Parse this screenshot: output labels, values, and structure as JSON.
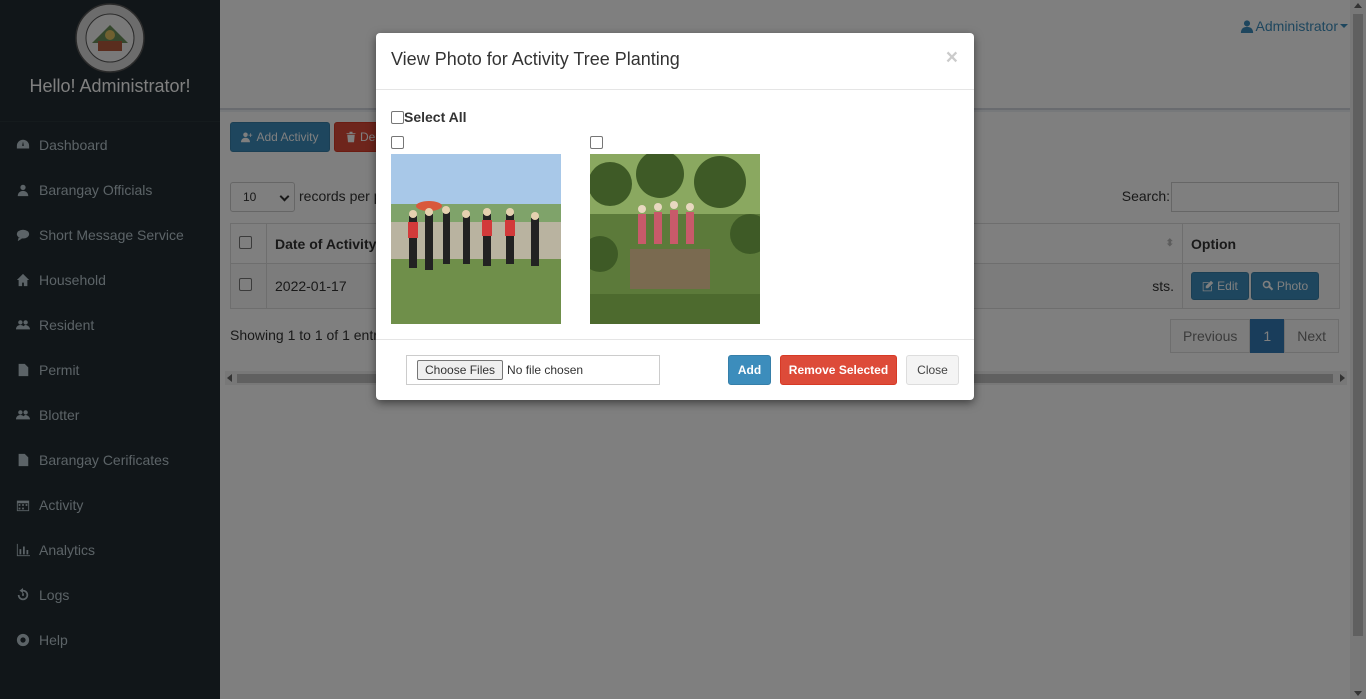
{
  "sidebar": {
    "greeting": "Hello! Administrator!",
    "items": [
      {
        "label": "Dashboard",
        "icon": "dashboard-icon"
      },
      {
        "label": "Barangay Officials",
        "icon": "user-icon"
      },
      {
        "label": "Short Message Service",
        "icon": "comment-icon"
      },
      {
        "label": "Household",
        "icon": "home-icon"
      },
      {
        "label": "Resident",
        "icon": "users-icon"
      },
      {
        "label": "Permit",
        "icon": "file-icon"
      },
      {
        "label": "Blotter",
        "icon": "users-icon"
      },
      {
        "label": "Barangay Cerificates",
        "icon": "file-icon"
      },
      {
        "label": "Activity",
        "icon": "calendar-icon"
      },
      {
        "label": "Analytics",
        "icon": "bar-chart-icon"
      },
      {
        "label": "Logs",
        "icon": "history-icon"
      },
      {
        "label": "Help",
        "icon": "life-ring-icon"
      }
    ]
  },
  "header": {
    "user": "Administrator"
  },
  "toolbar": {
    "add_label": "Add Activity",
    "delete_label": "Del"
  },
  "table": {
    "length_value": "10",
    "length_suffix": "records per p",
    "search_label": "Search:",
    "headers": {
      "date": "Date of Activity",
      "option": "Option"
    },
    "rows": [
      {
        "date": "2022-01-17",
        "desc_tail": "sts.",
        "edit": "Edit",
        "photo": "Photo"
      }
    ],
    "info": "Showing 1 to 1 of 1 entr",
    "pager": {
      "prev": "Previous",
      "current": "1",
      "next": "Next"
    }
  },
  "modal": {
    "title": "View Photo for Activity Tree Planting",
    "close_glyph": "×",
    "select_all": "Select All",
    "photos": [
      "photo-tree-planting-river",
      "photo-tree-planting-forest"
    ],
    "file_button": "Choose Files",
    "file_status": "No file chosen",
    "add_label": "Add",
    "remove_label": "Remove Selected",
    "close_label": "Close"
  },
  "colors": {
    "sidebar_bg": "#222d32",
    "primary": "#3c8dbc",
    "danger": "#dd4b39"
  }
}
